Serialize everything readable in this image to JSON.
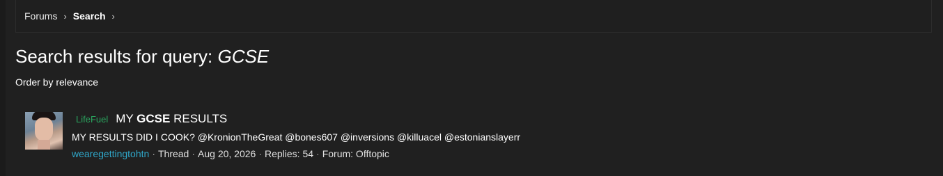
{
  "breadcrumb": {
    "items": [
      "Forums",
      "Search"
    ],
    "separator": "›"
  },
  "page": {
    "title_prefix": "Search results for query: ",
    "query": "GCSE",
    "order_label": "Order by relevance"
  },
  "results": [
    {
      "prefix_label": "LifeFuel",
      "title_before": "MY ",
      "title_highlight": "GCSE",
      "title_after": " RESULTS",
      "snippet": "MY RESULTS DID I COOK? @KronionTheGreat @bones607 @inversions @killuacel @estonianslayerr",
      "author": "wearegettingtohtn",
      "type": "Thread",
      "date": "Aug 20, 2026",
      "replies": "Replies: 54",
      "forum": "Forum: Offtopic"
    }
  ],
  "colors": {
    "background": "#202020",
    "prefix_green": "#2aa45e",
    "username_blue": "#2fa6c8"
  },
  "icons": {
    "avatar": "user-avatar-photo"
  }
}
